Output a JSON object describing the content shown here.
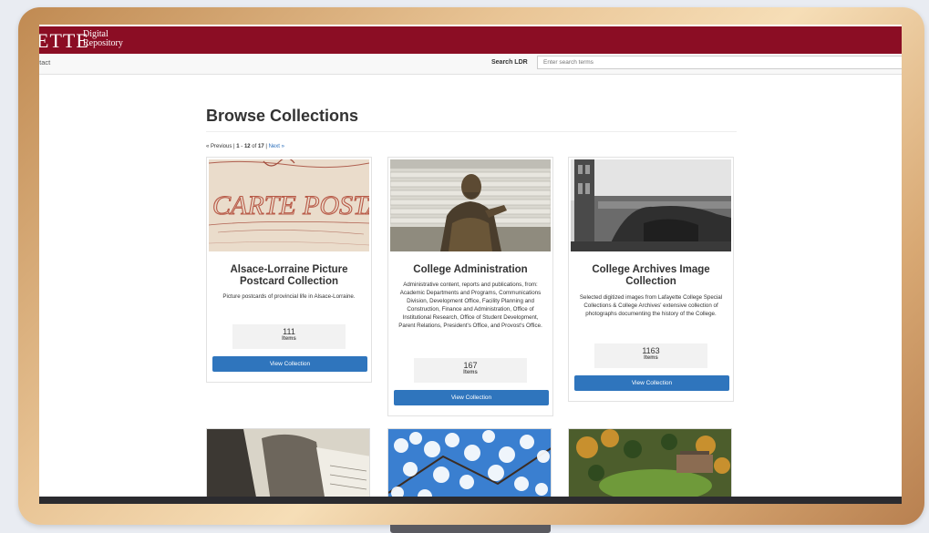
{
  "header": {
    "logo_text": "ETTE",
    "logo_line1": "Digital",
    "logo_line2": "Repository"
  },
  "nav": {
    "contact": "ntact",
    "search_label": "Search LDR",
    "search_placeholder": "Enter search terms",
    "search_value": ""
  },
  "page": {
    "title": "Browse Collections",
    "pager": {
      "prev": "« Previous",
      "sep1": " | ",
      "range_start": "1",
      "range_sep": " - ",
      "range_end": "12",
      "of": " of ",
      "total": "17",
      "sep2": " | ",
      "next": "Next »"
    }
  },
  "collections": [
    {
      "title": "Alsace-Lorraine Picture Postcard Collection",
      "description": "Picture postcards of provincial life in Alsace-Lorraine.",
      "count": "111",
      "count_label": "Items",
      "button": "View Collection",
      "image_text": "CARTE POSTALE",
      "image": "postcard-image"
    },
    {
      "title": "College Administration",
      "description": "Administrative content, reports and publications, from: Academic Departments and Programs, Communications Division, Development Office, Facility Planning and Construction, Finance and Administration, Office of Institutional Research, Office of Student Development, Parent Relations, President's Office, and Provost's Office.",
      "count": "167",
      "count_label": "Items",
      "button": "View Collection",
      "image": "statue-image"
    },
    {
      "title": "College Archives Image Collection",
      "description": "Selected digitized images from Lafayette College Special Collections & College Archives' extensive collection of photographs documenting the history of the College.",
      "count": "1163",
      "count_label": "Items",
      "button": "View Collection",
      "image": "campus-building-image"
    }
  ],
  "thumbnails": [
    {
      "image": "students-reading-image"
    },
    {
      "image": "cherry-blossoms-image"
    },
    {
      "image": "aerial-campus-image"
    }
  ],
  "colors": {
    "header_bg": "#8b0d24",
    "button_bg": "#2f75bd",
    "link": "#2a6ebb"
  }
}
